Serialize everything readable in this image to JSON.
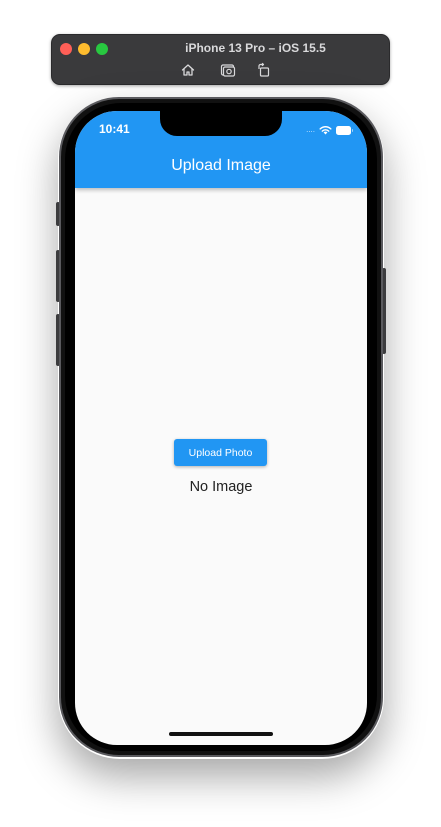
{
  "simulator": {
    "title": "iPhone 13 Pro – iOS 15.5",
    "icons": [
      "home-icon",
      "screenshot-icon",
      "rotate-icon"
    ]
  },
  "status_bar": {
    "time": "10:41"
  },
  "app_bar": {
    "title": "Upload Image",
    "color": "#2196f3"
  },
  "main": {
    "upload_button_label": "Upload Photo",
    "image_status": "No Image"
  }
}
